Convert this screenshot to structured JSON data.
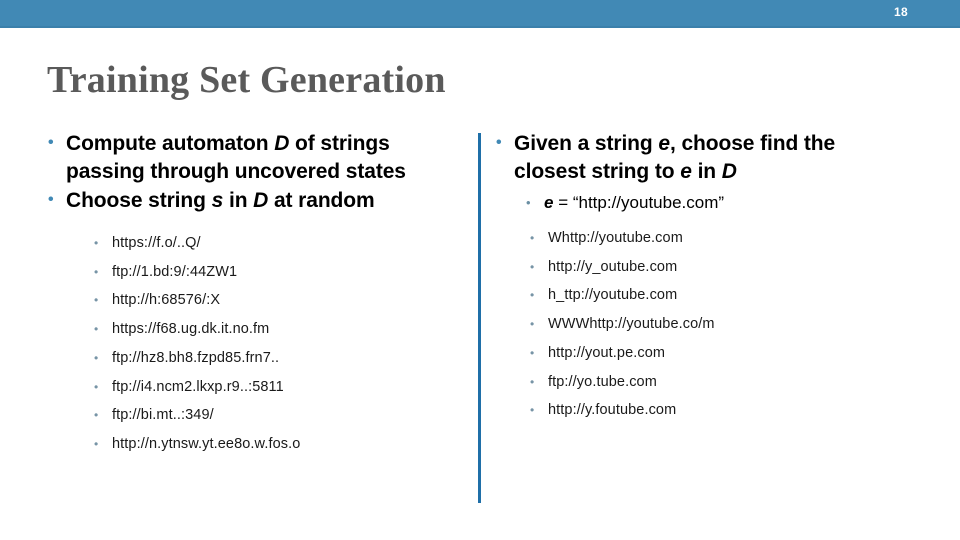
{
  "header": {
    "slide_number": "18",
    "bar_color": "#4189b5"
  },
  "title": "Training Set Generation",
  "title_color": "#5a5a5a",
  "divider_color": "#1f6fa8",
  "left_column": {
    "bullets": [
      {
        "parts": [
          {
            "text": "Compute automaton ",
            "style": "normal"
          },
          {
            "text": "D",
            "style": "italic"
          },
          {
            "text": " of strings passing through uncovered states",
            "style": "normal"
          }
        ]
      },
      {
        "parts": [
          {
            "text": "Choose string ",
            "style": "normal"
          },
          {
            "text": "s",
            "style": "italic"
          },
          {
            "text": " in ",
            "style": "normal"
          },
          {
            "text": "D",
            "style": "italic"
          },
          {
            "text": " at random",
            "style": "normal"
          }
        ]
      }
    ],
    "strings": [
      "https://f.o/..Q/",
      "ftp://1.bd:9/:44ZW1",
      "http://h:68576/:X",
      "https://f68.ug.dk.it.no.fm",
      "ftp://hz8.bh8.fzpd85.frn7..",
      "ftp://i4.ncm2.lkxp.r9..:5811",
      "ftp://bi.mt..:349/",
      "http://n.ytnsw.yt.ee8o.w.fos.o"
    ]
  },
  "right_column": {
    "bullets": [
      {
        "parts": [
          {
            "text": "Given a string ",
            "style": "normal"
          },
          {
            "text": "e",
            "style": "italic"
          },
          {
            "text": ", choose find the closest string to ",
            "style": "normal"
          },
          {
            "text": "e",
            "style": "italic"
          },
          {
            "text": " in ",
            "style": "normal"
          },
          {
            "text": "D",
            "style": "italic"
          }
        ]
      }
    ],
    "sub_bullet": {
      "parts": [
        {
          "text": "e",
          "style": "italic"
        },
        {
          "text": " = “http://youtube.com”",
          "style": "normal"
        }
      ]
    },
    "strings": [
      "Whttp://youtube.com",
      "http://y_outube.com",
      "h_ttp://youtube.com",
      "WWWhttp://youtube.co/m",
      "http://yout.pe.com",
      "ftp://yo.tube.com",
      "http://y.foutube.com"
    ]
  }
}
